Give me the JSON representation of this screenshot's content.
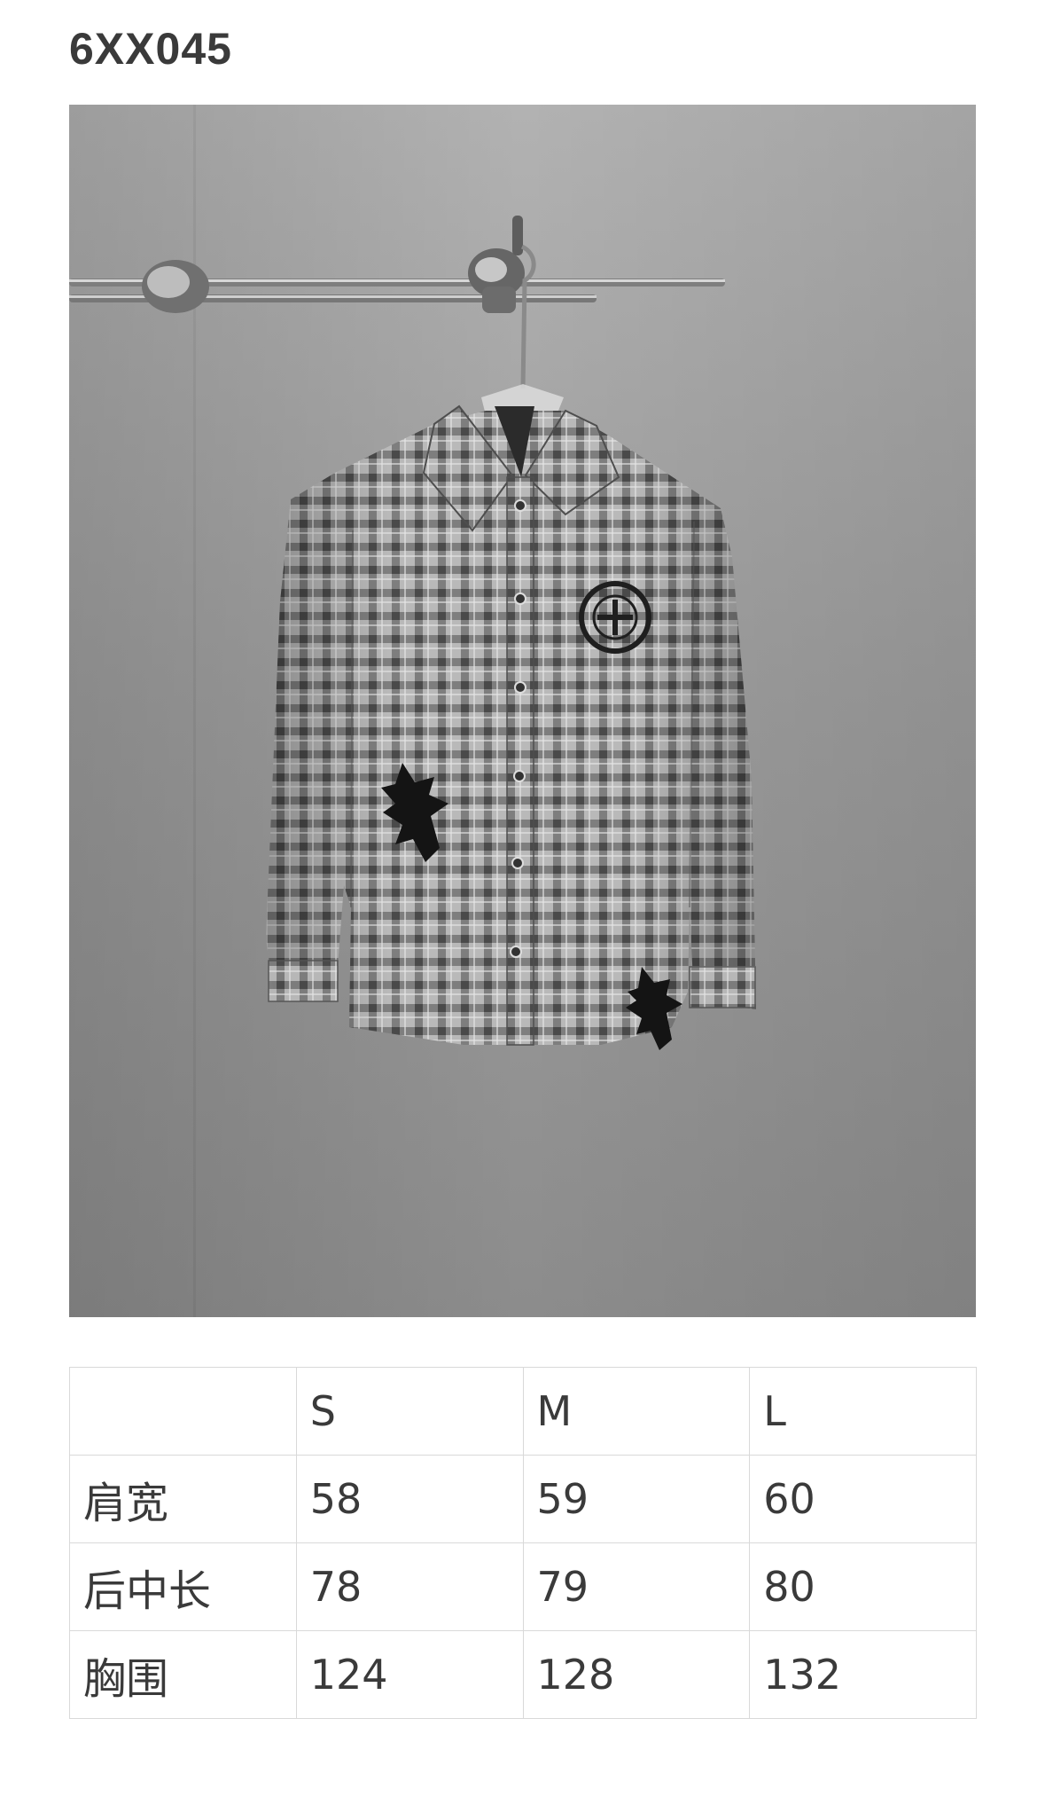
{
  "product": {
    "code": "6XX045"
  },
  "size_table": {
    "header": [
      "",
      "S",
      "M",
      "L"
    ],
    "rows": [
      {
        "label": "肩宽",
        "values": [
          "58",
          "59",
          "60"
        ]
      },
      {
        "label": "后中长",
        "values": [
          "78",
          "79",
          "80"
        ]
      },
      {
        "label": "胸围",
        "values": [
          "124",
          "128",
          "132"
        ]
      }
    ]
  },
  "colors": {
    "background_wall": "#8a8a8a",
    "shirt_base": "#9a9a9a",
    "shirt_check": "#5b5b5b",
    "patch": "#141414"
  }
}
